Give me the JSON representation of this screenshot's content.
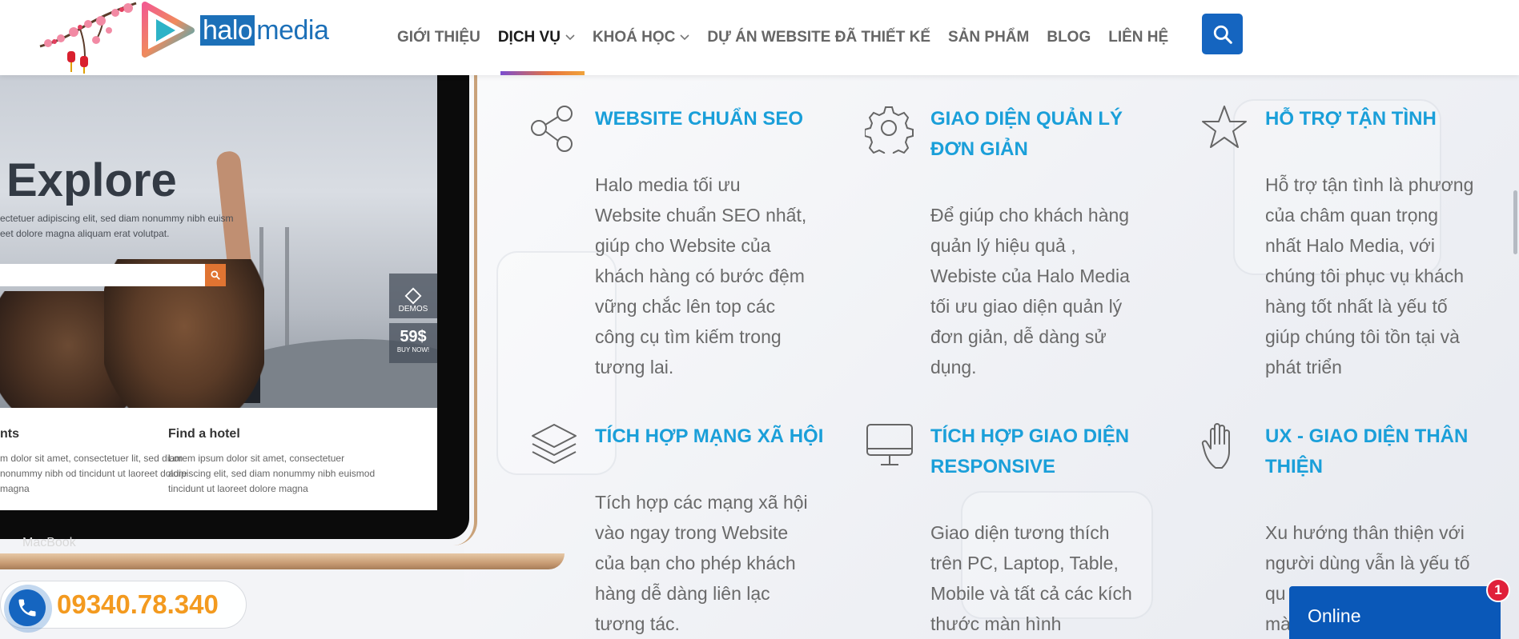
{
  "header": {
    "brand_box": "halo",
    "brand_text": "media",
    "nav": [
      {
        "label": "GIỚI THIỆU",
        "has_dropdown": false,
        "active": false
      },
      {
        "label": "DỊCH VỤ",
        "has_dropdown": true,
        "active": true
      },
      {
        "label": "KHOÁ HỌC",
        "has_dropdown": true,
        "active": false
      },
      {
        "label": "DỰ ÁN WEBSITE ĐÃ THIẾT KẾ",
        "has_dropdown": false,
        "active": false
      },
      {
        "label": "SẢN PHẨM",
        "has_dropdown": false,
        "active": false
      },
      {
        "label": "BLOG",
        "has_dropdown": false,
        "active": false
      },
      {
        "label": "LIÊN HỆ",
        "has_dropdown": false,
        "active": false
      }
    ],
    "search_icon": "search-icon"
  },
  "mockup": {
    "hero_title": "Explore",
    "hero_sub": "ectetuer adipiscing elit, sed diam nonummy nibh euism eet dolore magna aliquam erat volutpat.",
    "demos": "DEMOS",
    "price": "59$",
    "price_sub": "BUY NOW!",
    "col1_title": "nts",
    "col1_text": "m dolor sit amet, consectetuer lit, sed diam nonummy nibh od tincidunt ut laoreet dolore magna",
    "col2_title": "Find a hotel",
    "col2_text": "Lorem ipsum dolor sit amet, consectetuer adipiscing elit, sed diam nonummy nibh euismod tincidunt ut laoreet dolore magna",
    "device_label": "MacBook"
  },
  "features": [
    {
      "icon": "share-icon",
      "title": "WEBSITE CHUẨN SEO",
      "lines": [
        "Halo media tối ưu",
        "Website chuẩn SEO nhất,",
        "giúp cho Website của",
        "khách hàng có bước đệm",
        "vững chắc lên top các",
        "công cụ tìm kiếm trong",
        "tương lai."
      ]
    },
    {
      "icon": "gear-icon",
      "title_lines": [
        "GIAO DIỆN QUẢN LÝ",
        "ĐƠN GIẢN"
      ],
      "lines": [
        "Để giúp cho khách hàng",
        "quản lý hiệu quả ,",
        "Webiste của Halo Media",
        "tối ưu giao diện quản lý",
        "đơn giản, dễ dàng sử",
        "dụng."
      ]
    },
    {
      "icon": "star-icon",
      "title": "HỖ TRỢ TẬN TÌNH",
      "lines": [
        "Hỗ trợ tận tình là phương",
        "của châm quan trọng",
        "nhất Halo Media, với",
        "chúng tôi phục vụ khách",
        "hàng tốt nhất là yếu tố",
        "giúp chúng tôi tồn tại và",
        "phát triển"
      ]
    },
    {
      "icon": "layers-icon",
      "title": "TÍCH HỢP MẠNG XÃ HỘI",
      "lines": [
        "Tích hợp các mạng xã hội",
        "vào ngay trong Website",
        "của bạn cho phép khách",
        "hàng dễ dàng liên lạc",
        "tương tác."
      ]
    },
    {
      "icon": "desktop-icon",
      "title_lines": [
        "TÍCH HỢP GIAO DIỆN",
        "RESPONSIVE"
      ],
      "lines": [
        "Giao diện tương thích",
        "trên PC, Laptop, Table,",
        "Mobile và tất cả các kích",
        "thước màn hình"
      ]
    },
    {
      "icon": "hand-icon",
      "title_lines": [
        "UX - GIAO DIỆN THÂN",
        "THIỆN"
      ],
      "lines": [
        "Xu hướng thân thiện với",
        "người dùng vẫn  là yếu tố",
        "qu",
        "mà"
      ]
    }
  ],
  "phone": {
    "number": "09340.78.340",
    "icon": "phone-icon"
  },
  "chat": {
    "label": "Online",
    "badge": "1"
  },
  "colors": {
    "accent_blue": "#1a9fd9",
    "nav_active": "#1a1a1a",
    "nav_text": "#666666",
    "search_bg": "#1565c0",
    "phone_orange": "#f39a1f",
    "chat_bg": "#0a58b8",
    "badge_red": "#e0203a"
  }
}
